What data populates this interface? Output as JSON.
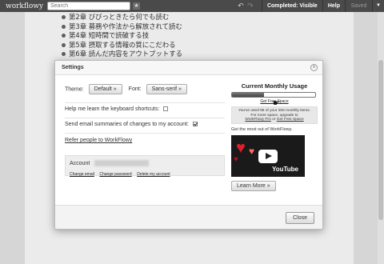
{
  "topbar": {
    "logo": "workflowy",
    "search_placeholder": "Search",
    "star_glyph": "★",
    "undo_glyph": "↶",
    "redo_glyph": "↷",
    "completed_label": "Completed: Visible",
    "help_label": "Help",
    "saved_label": "Saved",
    "menu_glyph": "▼"
  },
  "document": {
    "items": [
      "第2章 びびっときたら何でも読む",
      "第3章 募務や作法から解放されて読む",
      "第4章 短時間で読破する技",
      "第5章 摂取する情報の質にこだわる",
      "第6章 読んだ内容をアウトプットする"
    ]
  },
  "dialog": {
    "title": "Settings",
    "close_glyph": "x",
    "theme_label": "Theme:",
    "theme_value": "Default »",
    "font_label": "Font:",
    "font_value": "Sans-serif »",
    "shortcuts_label": "Help me learn the keyboard shortcuts:",
    "shortcuts_checked": false,
    "email_label": "Send email summaries of changes to my account:",
    "email_checked": true,
    "refer_link": "Refer people to WorkFlowy",
    "account_label": "Account",
    "account_links": {
      "change_email": "Change email",
      "change_password": "Change password",
      "delete_account": "Delete my account"
    },
    "usage": {
      "title": "Current Monthly Usage",
      "used_fraction": 0.38,
      "free_space_link": "Get Free Space",
      "line1": "You've used 95 of your 250 monthly items.",
      "line2": "For more space, upgrade to",
      "link_pro": "WorkFlowy Pro",
      "or_text": " or ",
      "link_free": "Get Free Space"
    },
    "promo_text": "Get the most out of WorkFlowy.",
    "video_brand": "YouTube",
    "learn_more": "Learn More »",
    "close_button": "Close"
  }
}
